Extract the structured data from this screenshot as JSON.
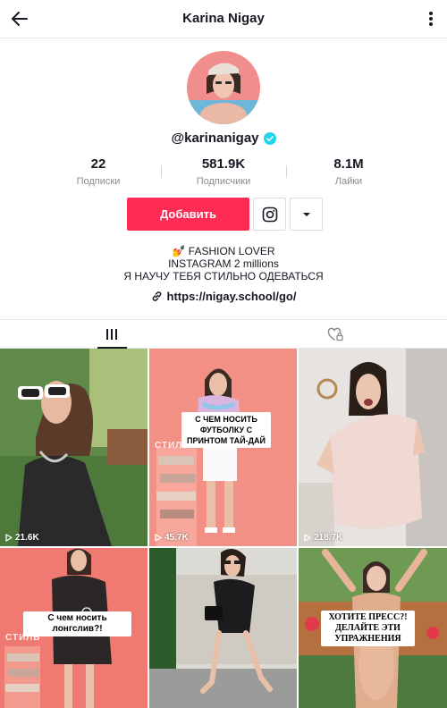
{
  "header": {
    "title": "Karina Nigay",
    "back_icon": "arrow-left-icon",
    "more_icon": "more-vertical-icon"
  },
  "profile": {
    "handle": "@karinanigay",
    "verified": true
  },
  "stats": [
    {
      "value": "22",
      "label": "Подписки"
    },
    {
      "value": "581.9K",
      "label": "Подписчики"
    },
    {
      "value": "8.1M",
      "label": "Лайки"
    }
  ],
  "actions": {
    "add_label": "Добавить",
    "instagram_icon": "instagram-icon",
    "dropdown_icon": "caret-down-icon"
  },
  "bio": {
    "line1": "💅 FASHION LOVER",
    "line2": "INSTAGRAM 2 millions",
    "line3": "Я НАУЧУ ТЕБЯ СТИЛЬНО ОДЕВАТЬСЯ"
  },
  "link": {
    "text": "https://nigay.school/go/",
    "icon": "link-icon"
  },
  "tabs": [
    {
      "name": "videos",
      "icon": "grid-bars-icon",
      "active": true
    },
    {
      "name": "liked",
      "icon": "heart-lock-icon",
      "active": false
    }
  ],
  "videos": [
    {
      "views": "21.6K",
      "caption": "",
      "stamp": ""
    },
    {
      "views": "45.7K",
      "caption": "С ЧЕМ НОСИТЬ ФУТБОЛКУ С ПРИНТОМ ТАЙ-ДАЙ",
      "stamp": "СТИЛЬ"
    },
    {
      "views": "218.7K",
      "caption": "",
      "stamp": ""
    },
    {
      "views": "",
      "caption": "С чем носить лонгслив?!",
      "stamp": "СТИЛЬ"
    },
    {
      "views": "",
      "caption": "",
      "stamp": ""
    },
    {
      "views": "",
      "caption": "ХОТИТЕ ПРЕСС?! ДЕЛАЙТЕ ЭТИ УПРАЖНЕНИЯ",
      "stamp": ""
    }
  ],
  "colors": {
    "accent": "#fe2c55",
    "verified": "#20d5ec",
    "text": "#161823",
    "muted": "#8a8b91"
  }
}
